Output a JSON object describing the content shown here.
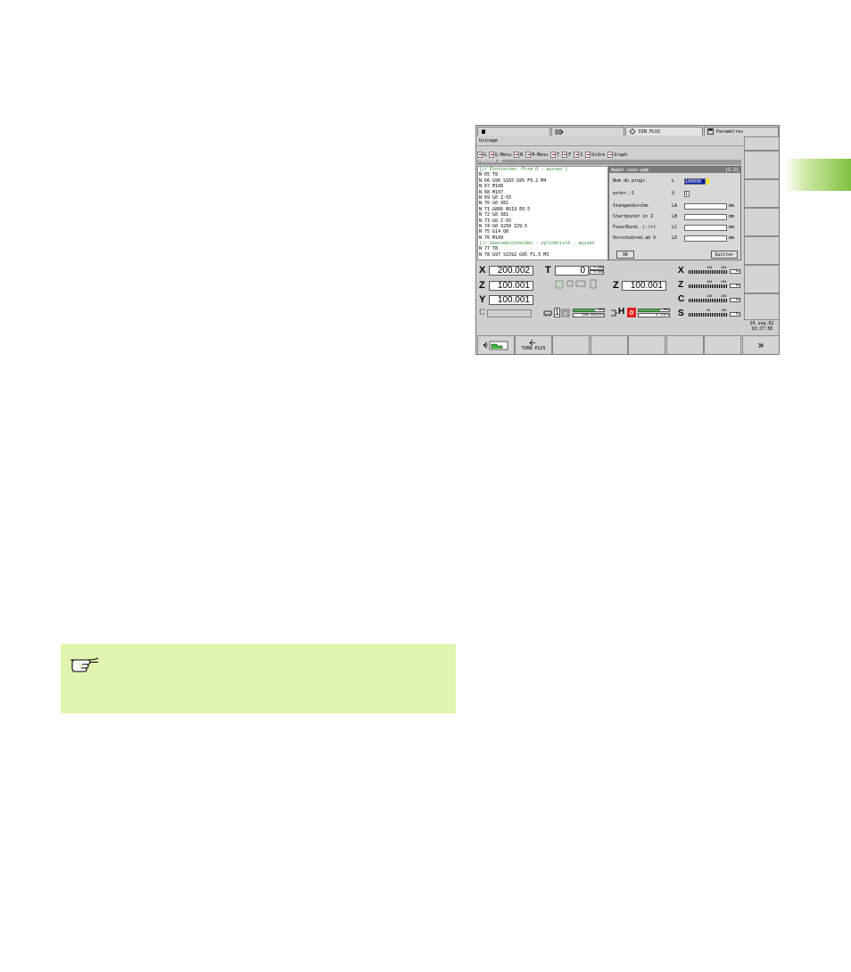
{
  "tabs": [
    {
      "icon": "hand-icon",
      "label": ""
    },
    {
      "icon": "arrow-right-icon",
      "label": ""
    },
    {
      "icon": "program-icon",
      "label": "DIN PLUS"
    },
    {
      "icon": "disk-icon",
      "label": "Paramètres"
    }
  ],
  "menu": {
    "label": "Usinage"
  },
  "toolbar": [
    {
      "label": "G"
    },
    {
      "label": "G-Menu"
    },
    {
      "label": "N"
    },
    {
      "label": "M-Menu"
    },
    {
      "label": "T"
    },
    {
      "label": "F"
    },
    {
      "label": "S"
    },
    {
      "label": "Ordre"
    },
    {
      "label": "Graph"
    }
  ],
  "file_label": "PROGRAM.NC",
  "program_lines": [
    {
      "text": "[// Einstechen -Form D - aussen ]",
      "comment": true
    },
    {
      "text": "N  65 T8",
      "comment": false
    },
    {
      "text": "N  66 G96 S165 G95 F0.2 M4",
      "comment": false
    },
    {
      "text": "N  67 M108",
      "comment": false
    },
    {
      "text": "N  68 M107",
      "comment": false
    },
    {
      "text": "N  69 G0 Z-55",
      "comment": false
    },
    {
      "text": "N  70 G0 X81",
      "comment": false
    },
    {
      "text": "N  71 G866 NS19 E0.5",
      "comment": false
    },
    {
      "text": "N  72 G0 X81",
      "comment": false
    },
    {
      "text": "N  73 G0 Z-55",
      "comment": false
    },
    {
      "text": "N  74 G0 X250 Z29.5",
      "comment": false
    },
    {
      "text": "N  75 G14 Q0",
      "comment": false
    },
    {
      "text": "N  76 M109",
      "comment": false
    },
    {
      "text": "[// Gewindeschneiden - zylindrisch - aussen",
      "comment": true
    },
    {
      "text": "N  77 T8",
      "comment": false
    },
    {
      "text": "N  78 G97 S1592 G95 F1.5 M3",
      "comment": false
    }
  ],
  "dialog": {
    "title": "Appel sous-pgm",
    "page": "[1-2]",
    "rows": [
      {
        "label": "Nom du progr.",
        "code": "L",
        "value": "100098",
        "unit": ""
      },
      {
        "label": "exter.:1",
        "code": "U",
        "value": "1",
        "unit": ""
      },
      {
        "label": "Stangendurchm.",
        "code": "LA",
        "value": "",
        "unit": "mm"
      },
      {
        "label": "Startpunkt in Z",
        "code": "LB",
        "value": "",
        "unit": "mm"
      },
      {
        "label": "Fase/Rund. (-/+)",
        "code": "LC",
        "value": "",
        "unit": "mm"
      },
      {
        "label": "Vorschubred.ab X",
        "code": "LD",
        "value": "",
        "unit": "mm"
      }
    ],
    "ok_label": "OK",
    "quit_label": "Quitter"
  },
  "axes": {
    "x_label": "X",
    "x_value": "200.002",
    "z_label": "Z",
    "z_value": "100.001",
    "y_label": "Y",
    "y_value": "100.001",
    "c_label": "C",
    "t_label": "T",
    "t_value": "0",
    "t_off1": "0.000",
    "t_off2": "0.000",
    "z2_label": "Z",
    "z2_value": "100.001"
  },
  "spindle": {
    "tool_num": "1",
    "feed_pct": "100%",
    "feed_text": "1000.0mm/min",
    "spindle_pct": "100%",
    "spindle_text": "0 1/min",
    "h_label": "H"
  },
  "load_meters": [
    {
      "label": "X",
      "pct": "0%",
      "s1": "100",
      "s2": "200"
    },
    {
      "label": "Z",
      "pct": "0%",
      "s1": "100",
      "s2": "200"
    },
    {
      "label": "C",
      "pct": "0%",
      "s1": "100",
      "s2": "200"
    },
    {
      "label": "S",
      "pct": "0%",
      "s1": "50",
      "s2": "100"
    }
  ],
  "datetime": {
    "date": "20.sep.02",
    "time": "10:27:38"
  },
  "bottom_softkeys": [
    {
      "label": "",
      "icon": "contour-icon"
    },
    {
      "label": "TURN PLUS",
      "icon": "turnplus-icon"
    },
    {
      "label": "",
      "icon": ""
    },
    {
      "label": "",
      "icon": ""
    },
    {
      "label": "",
      "icon": ""
    },
    {
      "label": "",
      "icon": ""
    },
    {
      "label": "",
      "icon": ""
    },
    {
      "label": "»",
      "icon": "next-icon"
    }
  ],
  "colors": {
    "accent_green": "#7fc241",
    "note_bg": "#e0f6b0",
    "comment": "#2f8a2f"
  }
}
